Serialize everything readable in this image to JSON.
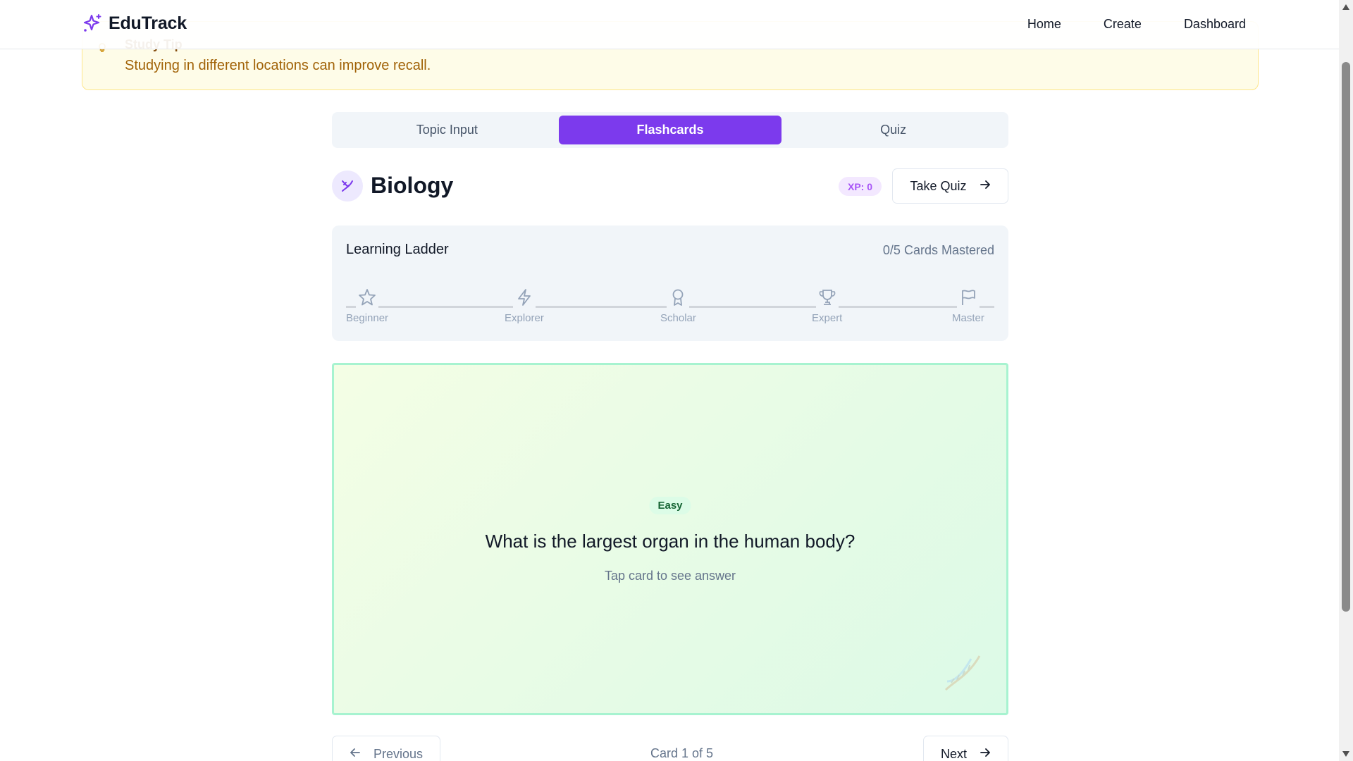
{
  "nav": {
    "brand": "EduTrack",
    "brand_icon": "sparkles-icon",
    "links": [
      "Home",
      "Create",
      "Dashboard"
    ]
  },
  "tip": {
    "title": "Study Tip",
    "text": "Studying in different locations can improve recall."
  },
  "tabs": [
    {
      "label": "Topic Input",
      "active": false
    },
    {
      "label": "Flashcards",
      "active": true
    },
    {
      "label": "Quiz",
      "active": false
    }
  ],
  "topic": {
    "title": "Biology",
    "icon": "dna-icon",
    "xp": "XP: 0",
    "take_quiz_label": "Take Quiz"
  },
  "ladder": {
    "title": "Learning Ladder",
    "count": "0/5 Cards Mastered",
    "steps": [
      {
        "label": "Beginner",
        "icon": "star-icon"
      },
      {
        "label": "Explorer",
        "icon": "lightning-icon"
      },
      {
        "label": "Scholar",
        "icon": "award-icon"
      },
      {
        "label": "Expert",
        "icon": "trophy-icon"
      },
      {
        "label": "Master",
        "icon": "flag-icon"
      }
    ]
  },
  "card": {
    "difficulty": "Easy",
    "question": "What is the largest organ in the human body?",
    "hint": "Tap card to see answer"
  },
  "pager": {
    "previous_label": "Previous",
    "card_count": "Card 1 of 5",
    "next_label": "Next"
  },
  "colors": {
    "accent": "#7c3aed",
    "tip_bg": "#fefce8",
    "card_border": "#a7f3d0"
  }
}
